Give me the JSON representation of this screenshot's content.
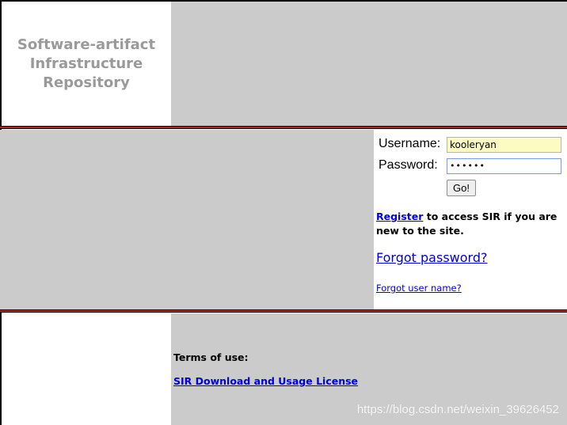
{
  "header": {
    "logo_line1": "Software-artifact",
    "logo_line2": "Infrastructure",
    "logo_line3": "Repository"
  },
  "login": {
    "username_label": "Username:",
    "username_value": "kooleryan",
    "password_label": "Password:",
    "password_value": "••••••",
    "go_label": "Go!",
    "register_link": "Register",
    "register_text": " to access SIR if you are new to the site.",
    "forgot_password": "Forgot password?",
    "forgot_username": "Forgot user name?"
  },
  "footer": {
    "terms_label": "Terms of use:",
    "license_link": "SIR Download and Usage License"
  },
  "watermark": "https://blog.csdn.net/weixin_39626452",
  "colors": {
    "panel_gray": "#cbcbcb",
    "logo_text": "#9a9a9a",
    "divider_red": "#b52424",
    "link_blue": "#0000d8",
    "autofill_yellow": "#fcfbc2"
  }
}
